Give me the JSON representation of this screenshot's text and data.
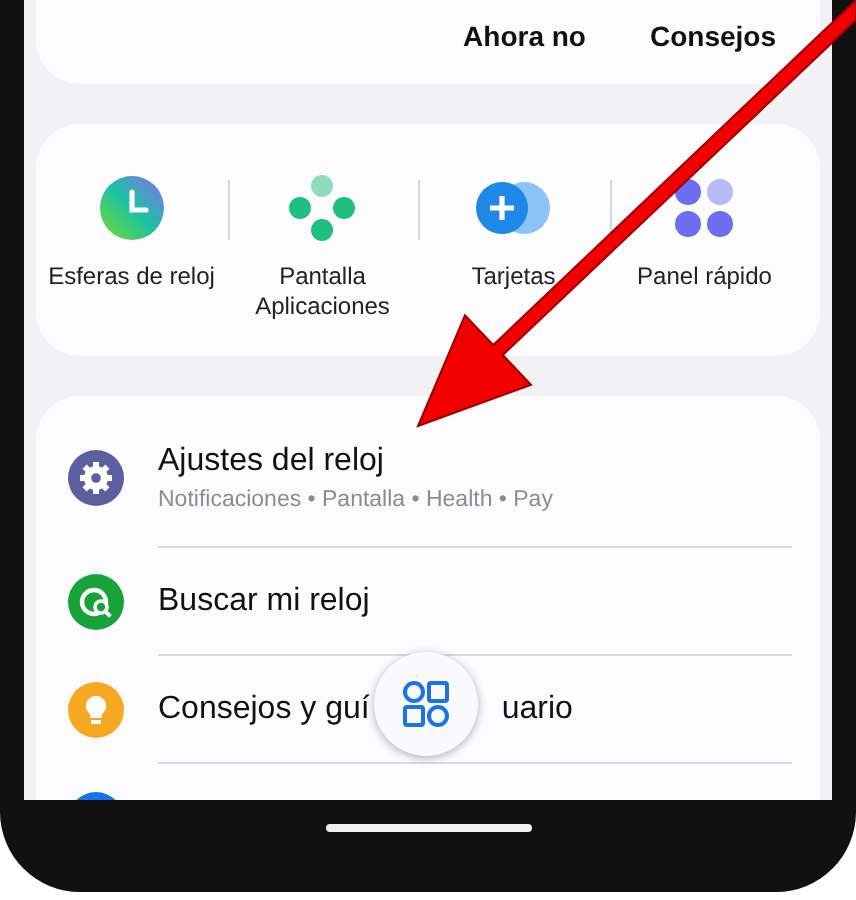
{
  "top_card": {
    "buttons": [
      "Ahora no",
      "Consejos"
    ]
  },
  "shortcuts": [
    {
      "label": "Esferas de reloj",
      "kind": "clock"
    },
    {
      "label": "Pantalla Aplicaciones",
      "kind": "apps"
    },
    {
      "label": "Tarjetas",
      "kind": "cards"
    },
    {
      "label": "Panel rápido",
      "kind": "panel"
    }
  ],
  "menu": [
    {
      "kind": "settings",
      "title": "Ajustes del reloj",
      "subtitle": "Notificaciones • Pantalla • Health • Pay"
    },
    {
      "kind": "find",
      "title": "Buscar mi reloj"
    },
    {
      "kind": "tips",
      "title": "Consejos y guí",
      "title_end": "uario"
    },
    {
      "kind": "more"
    }
  ]
}
